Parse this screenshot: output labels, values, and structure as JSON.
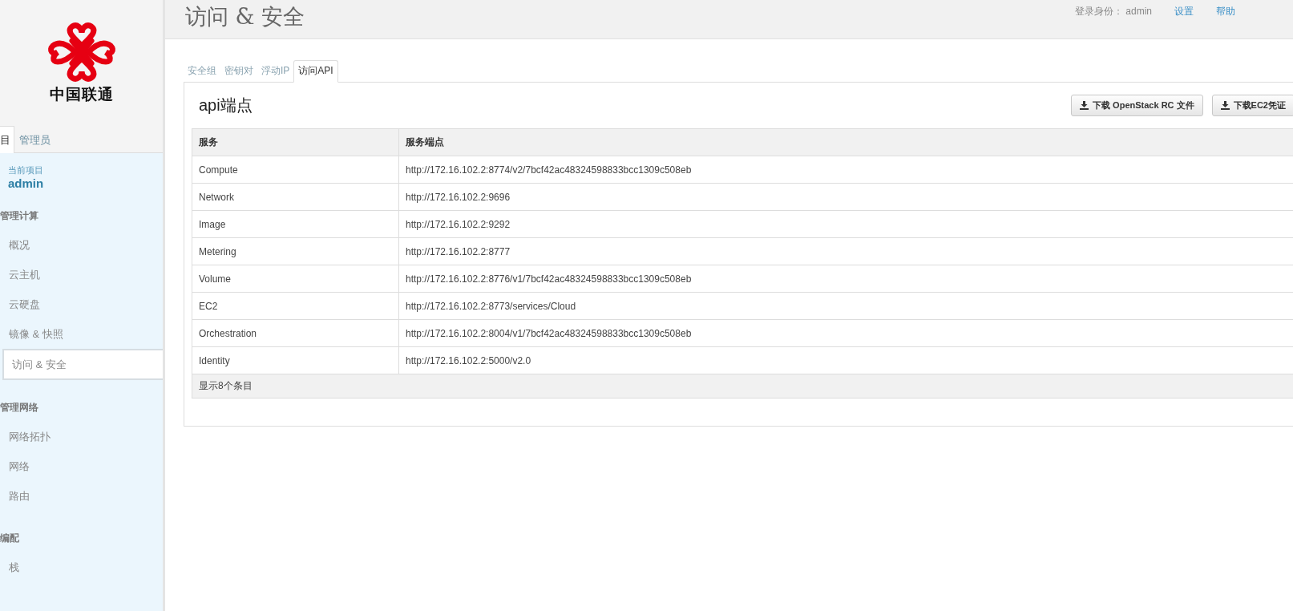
{
  "sidebar": {
    "brand": "中国联通",
    "tabs": [
      {
        "label": "目",
        "selected": true
      },
      {
        "label": "管理员",
        "selected": false
      }
    ],
    "current_project": {
      "label": "当前项目",
      "value": "admin"
    },
    "groups": [
      {
        "title": "管理计算",
        "items": [
          {
            "label": "概况",
            "selected": false
          },
          {
            "label": "云主机",
            "selected": false
          },
          {
            "label": "云硬盘",
            "selected": false
          },
          {
            "label": "镜像 & 快照",
            "selected": false
          },
          {
            "label": "访问 & 安全",
            "selected": true
          }
        ]
      },
      {
        "title": "管理网络",
        "items": [
          {
            "label": "网络拓扑",
            "selected": false
          },
          {
            "label": "网络",
            "selected": false
          },
          {
            "label": "路由",
            "selected": false
          }
        ]
      },
      {
        "title": "编配",
        "items": [
          {
            "label": "栈",
            "selected": false
          }
        ]
      }
    ]
  },
  "header": {
    "title": "访问 & 安全",
    "user_label": "登录身份：",
    "user": "admin",
    "links": [
      "设置",
      "帮助"
    ]
  },
  "tabs": [
    {
      "label": "安全组",
      "selected": false
    },
    {
      "label": "密钥对",
      "selected": false
    },
    {
      "label": "浮动IP",
      "selected": false
    },
    {
      "label": "访问API",
      "selected": true
    }
  ],
  "section": {
    "title": "api端点",
    "buttons": [
      "下载 OpenStack RC 文件",
      "下载EC2凭证"
    ]
  },
  "table": {
    "columns": [
      "服务",
      "服务端点"
    ],
    "rows": [
      [
        "Compute",
        "http://172.16.102.2:8774/v2/7bcf42ac48324598833bcc1309c508eb"
      ],
      [
        "Network",
        "http://172.16.102.2:9696"
      ],
      [
        "Image",
        "http://172.16.102.2:9292"
      ],
      [
        "Metering",
        "http://172.16.102.2:8777"
      ],
      [
        "Volume",
        "http://172.16.102.2:8776/v1/7bcf42ac48324598833bcc1309c508eb"
      ],
      [
        "EC2",
        "http://172.16.102.2:8773/services/Cloud"
      ],
      [
        "Orchestration",
        "http://172.16.102.2:8004/v1/7bcf42ac48324598833bcc1309c508eb"
      ],
      [
        "Identity",
        "http://172.16.102.2:5000/v2.0"
      ]
    ],
    "footer": "显示8个条目"
  }
}
